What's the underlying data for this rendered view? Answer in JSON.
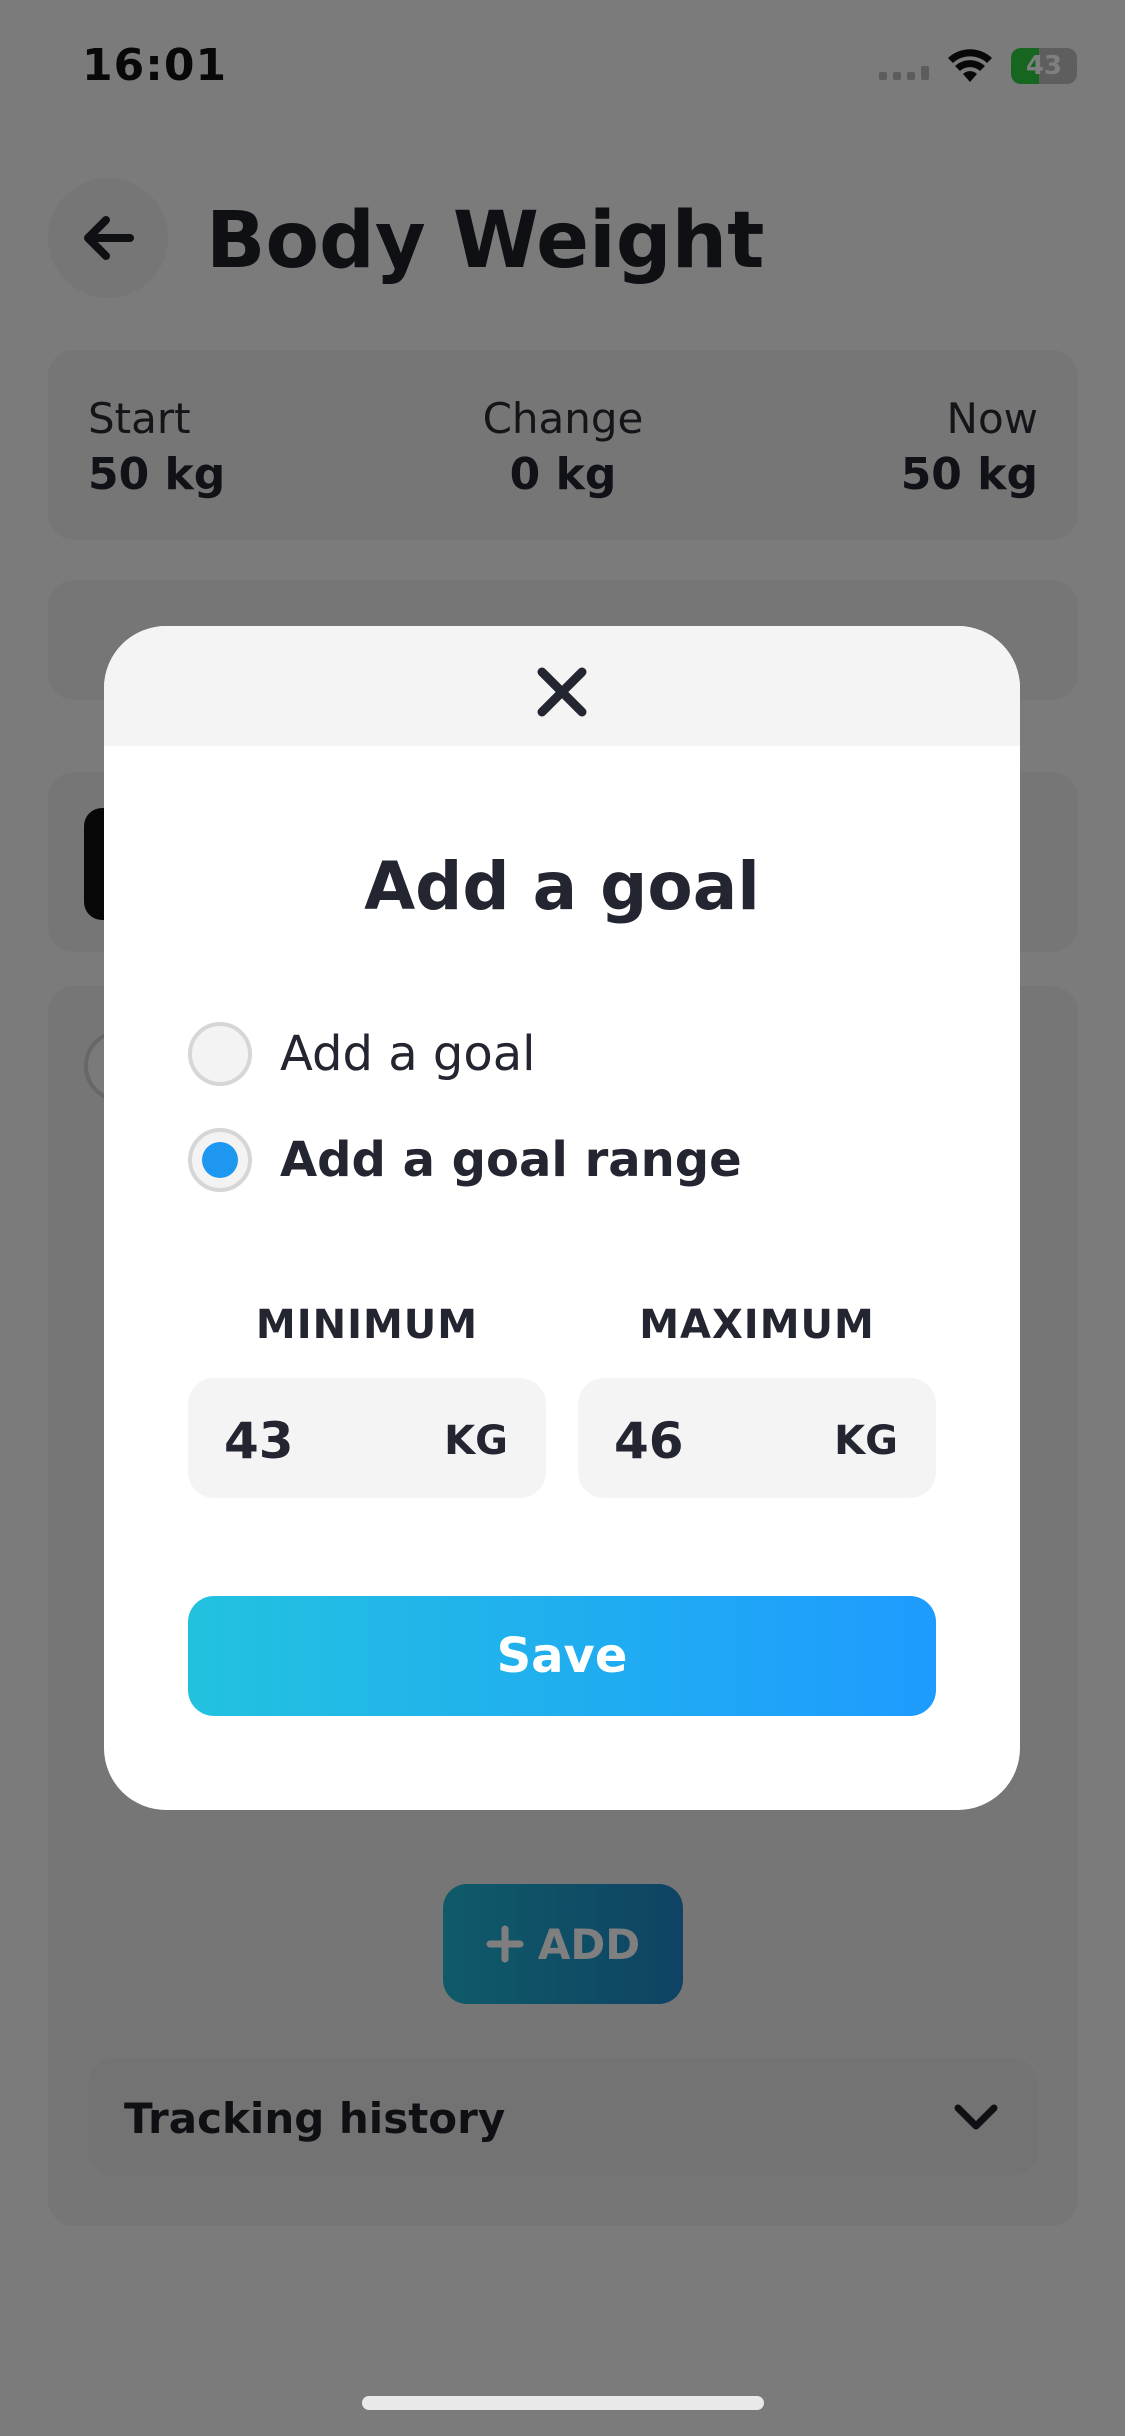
{
  "status_bar": {
    "time": "16:01",
    "battery": "43",
    "battery_level": 0.43
  },
  "header": {
    "title": "Body Weight",
    "back_icon": "arrow-left-icon"
  },
  "stats": {
    "start_label": "Start",
    "start_value": "50 kg",
    "change_label": "Change",
    "change_value": "0 kg",
    "now_label": "Now",
    "now_value": "50 kg"
  },
  "background": {
    "add_label": "ADD",
    "tracking_history": "Tracking history"
  },
  "modal": {
    "close_icon": "close-icon",
    "title": "Add a goal",
    "options": [
      {
        "label": "Add a goal",
        "selected": false
      },
      {
        "label": "Add a goal range",
        "selected": true
      }
    ],
    "minimum_label": "MINIMUM",
    "maximum_label": "MAXIMUM",
    "minimum_value": "43",
    "maximum_value": "46",
    "unit": "KG",
    "save_label": "Save"
  },
  "colors": {
    "accent": "#1e97f0",
    "save_gradient_start": "#22c2df",
    "save_gradient_end": "#1e9bff"
  }
}
